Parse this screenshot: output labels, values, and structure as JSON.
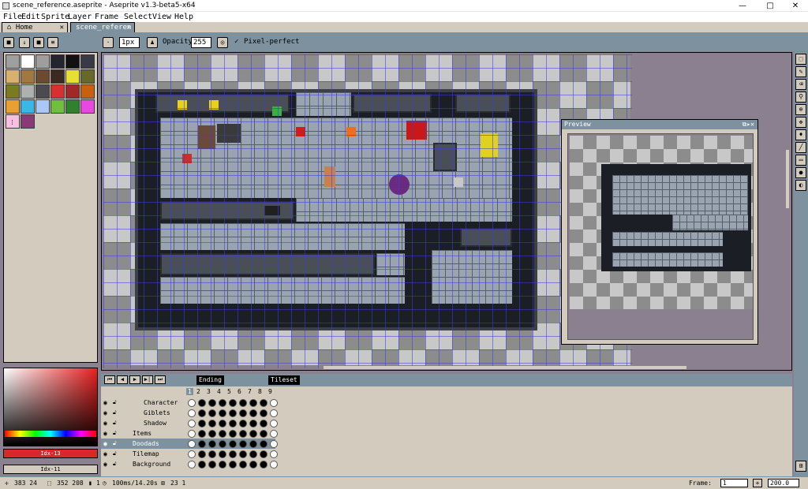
{
  "window": {
    "title": "scene_reference.aseprite - Aseprite v1.3-beta5-x64",
    "min": "—",
    "max": "□",
    "close": "✕"
  },
  "menu": [
    "File",
    "Edit",
    "Sprite",
    "Layer",
    "Frame",
    "Select",
    "View",
    "Help"
  ],
  "tabs": [
    {
      "label": "Home"
    },
    {
      "label": "scene_referen"
    }
  ],
  "context": {
    "brush_size": "1px",
    "opacity_label": "Opacity:",
    "opacity_value": "255",
    "pixel_perfect_label": "Pixel-perfect"
  },
  "palette": {
    "colors": [
      "#9f9f9f",
      "#ffffff",
      "#9e9e9e",
      "#252530",
      "#111111",
      "#3a3a44",
      "#d8b070",
      "#a07840",
      "#6a4a30",
      "#3c2a20",
      "#e8e030",
      "#686828",
      "#7a7a20",
      "#b0b0b0",
      "#4a4a50",
      "#d83030",
      "#a02828",
      "#c86010",
      "#e8a030",
      "#38b8e8",
      "#a8c8f8",
      "#70c040",
      "#308030",
      "#e848e0",
      "#f8c0e0",
      "#8a3878"
    ]
  },
  "colorbar": {
    "fg_label": "Idx-13",
    "bg_label": "Idx-11"
  },
  "preview": {
    "title": "Preview"
  },
  "timeline": {
    "tags": [
      "Ending",
      "Tileset"
    ],
    "frames": [
      "1",
      "2",
      "3",
      "4",
      "5",
      "6",
      "7",
      "8",
      "9"
    ],
    "layers": [
      {
        "name": "Character",
        "group": false,
        "indent": true
      },
      {
        "name": "Giblets",
        "group": false,
        "indent": true
      },
      {
        "name": "Shadow",
        "group": false,
        "indent": true
      },
      {
        "name": "Items",
        "group": false,
        "indent": false
      },
      {
        "name": "Doodads",
        "group": false,
        "indent": false,
        "selected": true
      },
      {
        "name": "Tilemap",
        "group": false,
        "indent": false,
        "tilemap": true
      },
      {
        "name": "Background",
        "group": false,
        "indent": false
      }
    ]
  },
  "status": {
    "cursor": "383 24",
    "selection": "352 208",
    "frame_num": "1",
    "duration": "100ms/14.20s",
    "size": "23 1",
    "frame_label": "Frame:",
    "frame_value": "1",
    "zoom": "200.0"
  },
  "icons": [
    "eye-icon",
    "lock-icon",
    "home-icon",
    "close-icon",
    "plus-icon",
    "play-icon"
  ]
}
